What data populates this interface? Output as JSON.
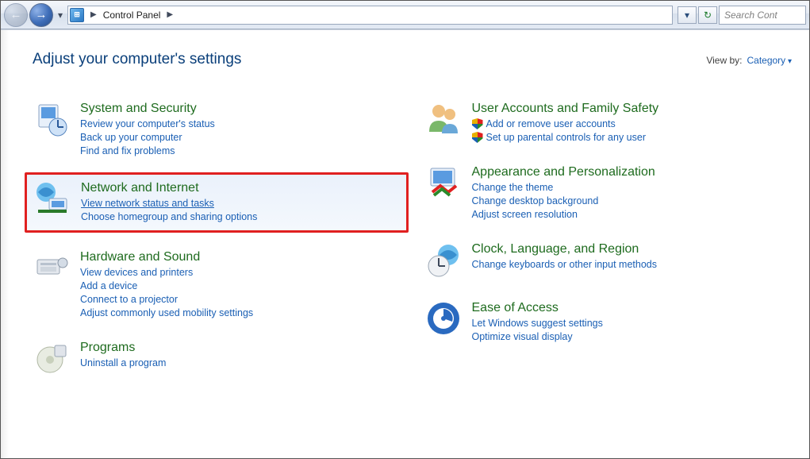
{
  "nav": {
    "breadcrumb_root": "Control Panel",
    "search_placeholder": "Search Cont"
  },
  "header": {
    "title": "Adjust your computer's settings",
    "viewby_label": "View by:",
    "viewby_value": "Category"
  },
  "categories": {
    "system": {
      "title": "System and Security",
      "links": [
        "Review your computer's status",
        "Back up your computer",
        "Find and fix problems"
      ]
    },
    "network": {
      "title": "Network and Internet",
      "links": [
        "View network status and tasks",
        "Choose homegroup and sharing options"
      ]
    },
    "hardware": {
      "title": "Hardware and Sound",
      "links": [
        "View devices and printers",
        "Add a device",
        "Connect to a projector",
        "Adjust commonly used mobility settings"
      ]
    },
    "programs": {
      "title": "Programs",
      "links": [
        "Uninstall a program"
      ]
    },
    "users": {
      "title": "User Accounts and Family Safety",
      "links": [
        "Add or remove user accounts",
        "Set up parental controls for any user"
      ]
    },
    "appearance": {
      "title": "Appearance and Personalization",
      "links": [
        "Change the theme",
        "Change desktop background",
        "Adjust screen resolution"
      ]
    },
    "clock": {
      "title": "Clock, Language, and Region",
      "links": [
        "Change keyboards or other input methods"
      ]
    },
    "ease": {
      "title": "Ease of Access",
      "links": [
        "Let Windows suggest settings",
        "Optimize visual display"
      ]
    }
  }
}
